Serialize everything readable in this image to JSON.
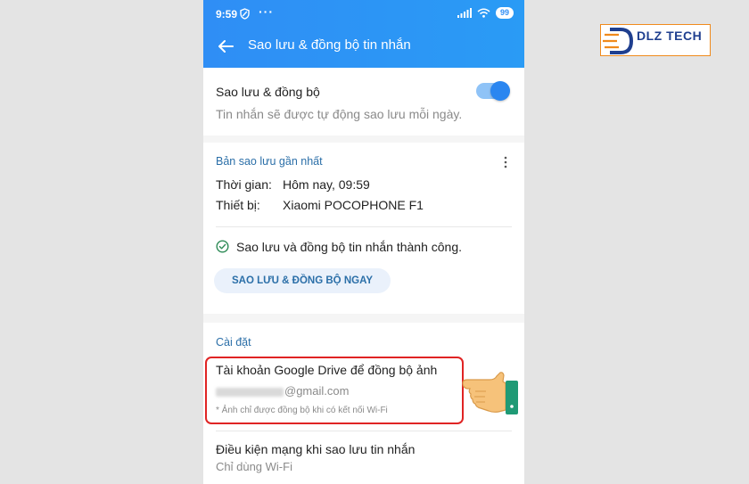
{
  "status": {
    "time": "9:59",
    "dots": "···",
    "battery": "99"
  },
  "appbar": {
    "title": "Sao lưu & đồng bộ tin nhắn",
    "back_icon": "arrow-left-icon"
  },
  "backup_sync": {
    "title": "Sao lưu & đồng bộ",
    "description": "Tin nhắn sẽ được tự động sao lưu mỗi ngày.",
    "enabled": true
  },
  "latest_backup": {
    "heading": "Bản sao lưu gần nhất",
    "time_label": "Thời gian:",
    "time_value": "Hôm nay, 09:59",
    "device_label": "Thiết bị:",
    "device_value": "Xiaomi POCOPHONE F1",
    "status_message": "Sao lưu và đồng bộ tin nhắn thành công.",
    "sync_button": "SAO LƯU & ĐỒNG BỘ NGAY"
  },
  "settings": {
    "heading": "Cài đặt",
    "drive_title": "Tài khoản Google Drive để đồng bộ ảnh",
    "drive_email": "@gmail.com",
    "drive_note": "* Ảnh chỉ được đồng bộ khi có kết nối Wi-Fi",
    "network_title": "Điều kiện mạng khi sao lưu tin nhắn",
    "network_value": "Chỉ dùng Wi-Fi"
  },
  "watermark": {
    "brand": "DLZ TECH"
  },
  "colors": {
    "appbar": "#2f8ef5",
    "accent": "#2a86f0",
    "section_heading": "#2b6fa8",
    "highlight": "#e02424",
    "success": "#2e8b57"
  }
}
